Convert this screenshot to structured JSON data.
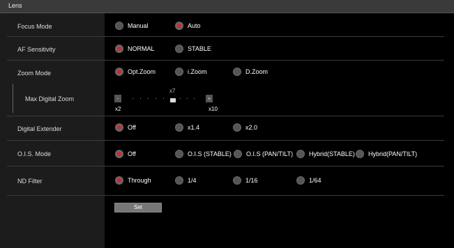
{
  "header": {
    "title": "Lens"
  },
  "rows": {
    "focus_mode": {
      "label": "Focus Mode",
      "options": [
        "Manual",
        "Auto"
      ],
      "selected": "Auto"
    },
    "af_sensitivity": {
      "label": "AF Sensitivity",
      "options": [
        "NORMAL",
        "STABLE"
      ],
      "selected": "NORMAL"
    },
    "zoom_mode": {
      "label": "Zoom Mode",
      "options": [
        "Opt.Zoom",
        "i.Zoom",
        "D.Zoom"
      ],
      "selected": "Opt.Zoom"
    },
    "max_digital_zoom": {
      "label": "Max Digital Zoom",
      "min_label": "x2",
      "max_label": "x10",
      "value_label": "x7",
      "minus": "-",
      "plus": "+"
    },
    "digital_extender": {
      "label": "Digital Extender",
      "options": [
        "Off",
        "x1.4",
        "x2.0"
      ],
      "selected": "Off"
    },
    "ois_mode": {
      "label": "O.I.S. Mode",
      "options": [
        "Off",
        "O.I.S (STABLE)",
        "O.I.S (PAN/TILT)",
        "Hybrid(STABLE)",
        "Hybrid(PAN/TILT)"
      ],
      "selected": "Off"
    },
    "nd_filter": {
      "label": "ND Filter",
      "options": [
        "Through",
        "1/4",
        "1/16",
        "1/64"
      ],
      "selected": "Through"
    }
  },
  "set_button": {
    "label": "Set"
  },
  "colors": {
    "accent": "#e02222",
    "panel": "#1c1c1c",
    "header": "#3a3a3a"
  }
}
